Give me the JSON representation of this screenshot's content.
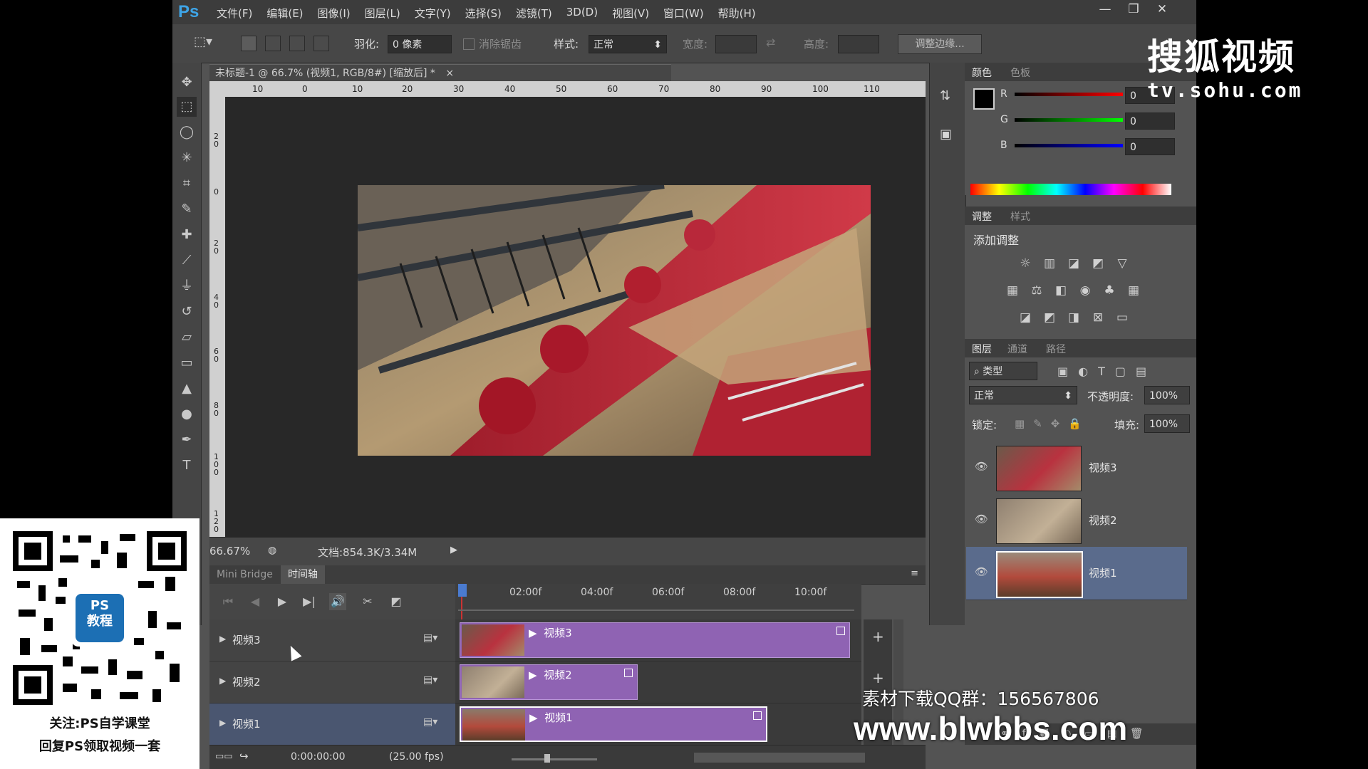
{
  "app": {
    "logo": "Ps",
    "menu": [
      "文件(F)",
      "编辑(E)",
      "图像(I)",
      "图层(L)",
      "文字(Y)",
      "选择(S)",
      "滤镜(T)",
      "3D(D)",
      "视图(V)",
      "窗口(W)",
      "帮助(H)"
    ],
    "window_controls": [
      "—",
      "❐",
      "✕"
    ]
  },
  "options_bar": {
    "feather_label": "羽化:",
    "feather_value": "0 像素",
    "antialias_label": "消除锯齿",
    "style_label": "样式:",
    "style_value": "正常",
    "width_label": "宽度:",
    "height_label": "高度:",
    "refine_button": "调整边缘..."
  },
  "document": {
    "tab_title": "未标题-1 @ 66.7% (视频1, RGB/8#) [缩放后] *",
    "tab_close": "×",
    "ruler_h": [
      "10",
      "0",
      "10",
      "20",
      "30",
      "40",
      "50",
      "60",
      "70",
      "80",
      "90",
      "100",
      "110"
    ],
    "ruler_v": [
      "2\n0",
      "0",
      "2\n0",
      "4\n0",
      "6\n0",
      "8\n0",
      "1\n0\n0",
      "1\n2\n0"
    ],
    "zoom": "66.67%",
    "doc_info": "文档:854.3K/3.34M"
  },
  "timeline": {
    "tabs": [
      "Mini Bridge",
      "时间轴"
    ],
    "ticks": [
      "02:00f",
      "04:00f",
      "06:00f",
      "08:00f",
      "10:00f"
    ],
    "tracks": [
      {
        "name": "视频3",
        "clip": "视频3"
      },
      {
        "name": "视频2",
        "clip": "视频2"
      },
      {
        "name": "视频1",
        "clip": "视频1"
      }
    ],
    "timecode": "0:00:00:00",
    "fps": "(25.00 fps)"
  },
  "color_panel": {
    "tabs": [
      "颜色",
      "色板"
    ],
    "r_label": "R",
    "r_value": "0",
    "g_label": "G",
    "g_value": "0",
    "b_label": "B",
    "b_value": "0"
  },
  "adjust_panel": {
    "tabs": [
      "调整",
      "样式"
    ],
    "title": "添加调整"
  },
  "layers_panel": {
    "tabs": [
      "图层",
      "通道",
      "路径"
    ],
    "filter": "类型",
    "blend_mode": "正常",
    "opacity_label": "不透明度:",
    "opacity_value": "100%",
    "lock_label": "锁定:",
    "fill_label": "填充:",
    "fill_value": "100%",
    "layers": [
      {
        "name": "视频3"
      },
      {
        "name": "视频2"
      },
      {
        "name": "视频1"
      }
    ]
  },
  "overlays": {
    "watermark_logo": "搜狐视频",
    "watermark_url": "tv.sohu.com",
    "qr_line1": "关注:PS自学课堂",
    "qr_line2": "回复PS领取视频一套",
    "qr_center": "PS\n教程",
    "qq_group": "素材下载QQ群：156567806",
    "site": "www.blwbbs.com"
  },
  "colors": {
    "clip_purple": "#8f63b3",
    "selected_layer": "#5a6b8c",
    "ps_blue": "#3ea5e8"
  }
}
